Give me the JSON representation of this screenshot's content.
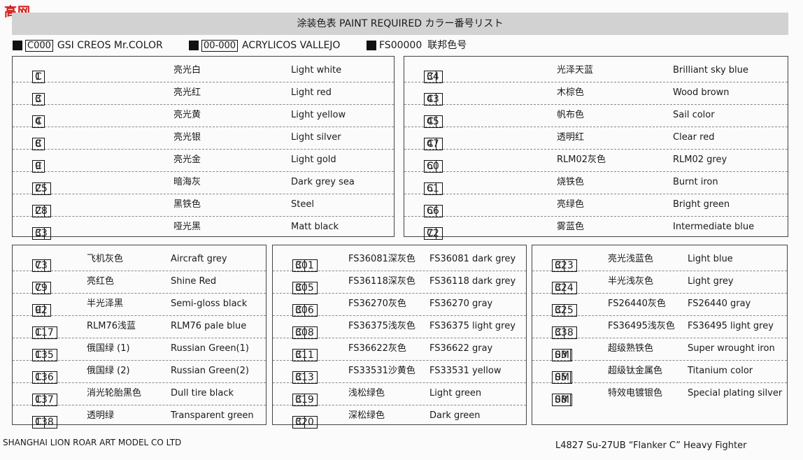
{
  "watermark": "高网",
  "title": "涂装色表  PAINT REQUIRED  カラー番号リスト",
  "legend": [
    {
      "code": "C000",
      "label": "GSI CREOS Mr.COLOR"
    },
    {
      "code": "00-000",
      "label": "ACRYLICOS VALLEJO"
    },
    {
      "code": "FS00000",
      "label": "联邦色号"
    }
  ],
  "panels": {
    "top_left": [
      {
        "prefix": "C",
        "num": "1",
        "cn": "亮光白",
        "en": "Light white"
      },
      {
        "prefix": "C",
        "num": "3",
        "cn": "亮光红",
        "en": "Light red"
      },
      {
        "prefix": "C",
        "num": "4",
        "cn": "亮光黄",
        "en": "Light yellow"
      },
      {
        "prefix": "C",
        "num": "8",
        "cn": "亮光银",
        "en": "Light silver"
      },
      {
        "prefix": "C",
        "num": "9",
        "cn": "亮光金",
        "en": "Light gold"
      },
      {
        "prefix": "C",
        "num": "25",
        "cn": "暗海灰",
        "en": "Dark grey sea"
      },
      {
        "prefix": "C",
        "num": "28",
        "cn": "黑铁色",
        "en": "Steel"
      },
      {
        "prefix": "C",
        "num": "33",
        "cn": "哑光黑",
        "en": "Matt black"
      }
    ],
    "top_right": [
      {
        "prefix": "C",
        "num": "34",
        "cn": "光泽天蓝",
        "en": "Brilliant sky blue"
      },
      {
        "prefix": "C",
        "num": "43",
        "cn": "木棕色",
        "en": "Wood brown"
      },
      {
        "prefix": "C",
        "num": "45",
        "cn": "帆布色",
        "en": "Sail color"
      },
      {
        "prefix": "C",
        "num": "47",
        "cn": "透明红",
        "en": "Clear red"
      },
      {
        "prefix": "C",
        "num": "60",
        "cn": "RLM02灰色",
        "en": "RLM02 grey"
      },
      {
        "prefix": "C",
        "num": "61",
        "cn": "烧铁色",
        "en": "Burnt iron"
      },
      {
        "prefix": "C",
        "num": "66",
        "cn": "亮绿色",
        "en": "Bright green"
      },
      {
        "prefix": "C",
        "num": "72",
        "cn": "雾蓝色",
        "en": "Intermediate blue"
      }
    ],
    "bottom_left": [
      {
        "prefix": "C",
        "num": "73",
        "cn": "飞机灰色",
        "en": "Aircraft grey"
      },
      {
        "prefix": "C",
        "num": "79",
        "cn": "亮红色",
        "en": "Shine Red"
      },
      {
        "prefix": "C",
        "num": "92",
        "cn": "半光泽黑",
        "en": "Semi-gloss black"
      },
      {
        "prefix": "C",
        "num": "117",
        "cn": "RLM76浅蓝",
        "en": "RLM76 pale blue"
      },
      {
        "prefix": "C",
        "num": "135",
        "cn": "俄国绿 (1)",
        "en": "Russian Green(1)"
      },
      {
        "prefix": "C",
        "num": "136",
        "cn": "俄国绿 (2)",
        "en": "Russian Green(2)"
      },
      {
        "prefix": "C",
        "num": "137",
        "cn": "消光轮胎黑色",
        "en": "Dull tire black"
      },
      {
        "prefix": "C",
        "num": "138",
        "cn": "透明绿",
        "en": "Transparent green"
      }
    ],
    "bottom_mid": [
      {
        "prefix": "C",
        "num": "301",
        "cn": "FS36081深灰色",
        "en": "FS36081 dark grey"
      },
      {
        "prefix": "C",
        "num": "305",
        "cn": "FS36118深灰色",
        "en": "FS36118 dark grey"
      },
      {
        "prefix": "C",
        "num": "306",
        "cn": "FS36270灰色",
        "en": "FS36270 gray"
      },
      {
        "prefix": "C",
        "num": "308",
        "cn": "FS36375浅灰色",
        "en": "FS36375 light grey"
      },
      {
        "prefix": "C",
        "num": "311",
        "cn": "FS36622灰色",
        "en": "FS36622 gray"
      },
      {
        "prefix": "C",
        "num": "313",
        "cn": "FS33531沙黄色",
        "en": "FS33531 yellow"
      },
      {
        "prefix": "C",
        "num": "319",
        "cn": "浅松绿色",
        "en": "Light green"
      },
      {
        "prefix": "C",
        "num": "320",
        "cn": "深松绿色",
        "en": "Dark green"
      }
    ],
    "bottom_right": [
      {
        "prefix": "C",
        "num": "323",
        "cn": "亮光浅蓝色",
        "en": "Light blue"
      },
      {
        "prefix": "C",
        "num": "324",
        "cn": "半光浅灰色",
        "en": "Light grey"
      },
      {
        "prefix": "C",
        "num": "325",
        "cn": "FS26440灰色",
        "en": "FS26440 gray"
      },
      {
        "prefix": "C",
        "num": "338",
        "cn": "FS36495浅灰色",
        "en": "FS36495 light grey"
      },
      {
        "prefix": "SM",
        "num": "03",
        "cn": "超级熟铁色",
        "en": "Super wrought iron"
      },
      {
        "prefix": "SM",
        "num": "05",
        "cn": "超级钛金属色",
        "en": "Titanium color"
      },
      {
        "prefix": "SM",
        "num": "08",
        "cn": "特效电镀银色",
        "en": "Special plating silver"
      }
    ]
  },
  "footer": {
    "company": "SHANGHAI LION ROAR ART MODEL CO LTD",
    "model": "L4827  Su-27UB  “Flanker C” Heavy Fighter"
  }
}
